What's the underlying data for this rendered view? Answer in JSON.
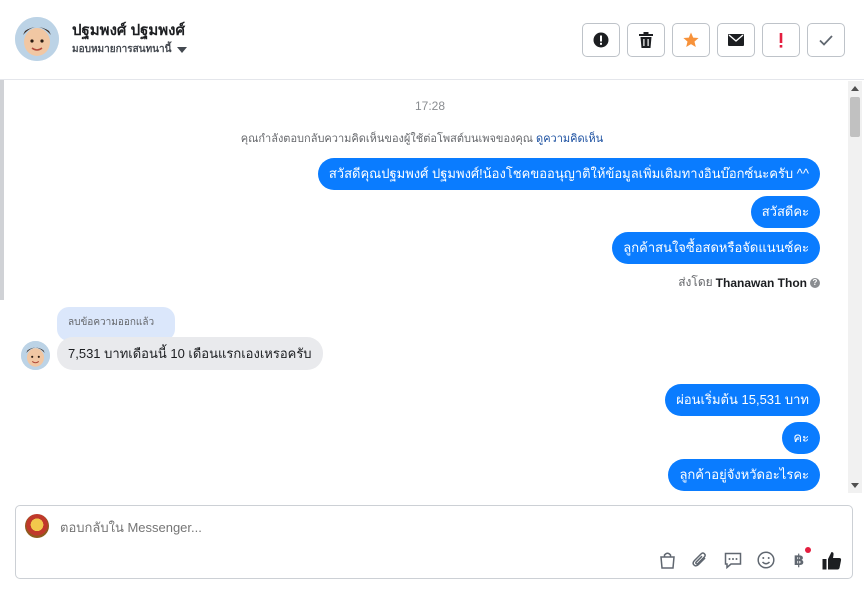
{
  "header": {
    "user_name": "ปฐมพงศ์ ปฐมพงศ์",
    "assign_label": "มอบหมายการสนทนานี้",
    "actions": [
      {
        "icon": "alert-circle-icon"
      },
      {
        "icon": "trash-icon"
      },
      {
        "icon": "star-icon",
        "color": "#f7923a"
      },
      {
        "icon": "envelope-icon"
      },
      {
        "icon": "exclamation-icon",
        "color": "#e41e3f"
      },
      {
        "icon": "check-icon"
      }
    ]
  },
  "chat": {
    "timestamp": "17:28",
    "notice_text": "คุณกำลังตอบกลับความคิดเห็นของผู้ใช้ต่อโพสต์บนเพจของคุณ",
    "notice_link": "ดูความคิดเห็น",
    "outgoing_group_1": [
      "สวัสดีคุณปฐมพงศ์ ปฐมพงศ์!น้องโชคขออนุญาติให้ข้อมูลเพิ่มเติมทางอินบ๊อกซ์นะครับ ^^",
      "สวัสดีคะ",
      "ลูกค้าสนใจซื้อสดหรือจัดแนนซ์คะ"
    ],
    "sent_by_label": "ส่งโดย",
    "sent_by_name": "Thanawan Thon",
    "deleted_label": "ลบข้อความออกแล้ว",
    "incoming_message": "7,531 บาทเดือนนี้ 10 เดือนแรกเองเหรอครับ",
    "outgoing_group_2": [
      "ผ่อนเริ่มต้น 15,531 บาท",
      "คะ",
      "ลูกค้าอยู่จังหวัดอะไรคะ"
    ]
  },
  "composer": {
    "placeholder": "ตอบกลับใน Messenger...",
    "tools": [
      "bag-icon",
      "paperclip-icon",
      "chat-bubble-icon",
      "smiley-icon",
      "baht-icon",
      "thumbs-up-icon"
    ],
    "baht_symbol": "฿"
  },
  "colors": {
    "accent": "#0a7cff",
    "incoming_bg": "#e9eaed",
    "deleted_bg": "#dbe7fb"
  }
}
